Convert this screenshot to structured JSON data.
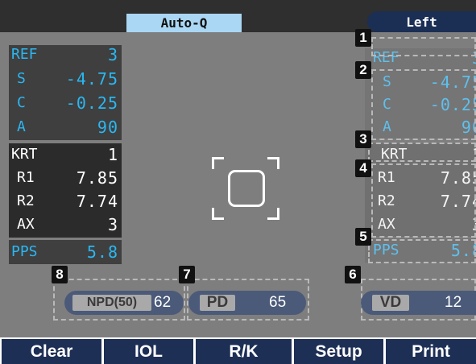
{
  "header": {
    "mode_label": "Auto-Q",
    "eye_label": "Left"
  },
  "left_panel": {
    "ref": {
      "title": "REF",
      "title_value": "3",
      "rows": [
        {
          "label": "S",
          "value": "-4.75"
        },
        {
          "label": "C",
          "value": "-0.25"
        },
        {
          "label": "A",
          "value": "90"
        }
      ]
    },
    "krt": {
      "title": "KRT",
      "title_value": "1",
      "rows": [
        {
          "label": "R1",
          "value": "7.85"
        },
        {
          "label": "R2",
          "value": "7.74"
        },
        {
          "label": "AX",
          "value": "3"
        }
      ]
    },
    "pps": {
      "label": "PPS",
      "value": "5.8"
    }
  },
  "markers": [
    "1",
    "2",
    "3",
    "4",
    "5",
    "6",
    "7",
    "8"
  ],
  "measurements": {
    "npd": {
      "label": "NPD(50)",
      "value": "62"
    },
    "pd": {
      "label": "PD",
      "value": "65"
    },
    "vd": {
      "label": "VD",
      "value": "12"
    }
  },
  "buttons": [
    "Clear",
    "IOL",
    "R/K",
    "Setup",
    "Print"
  ],
  "colors": {
    "screen_bg": "#7e7e7e",
    "cyan_text": "#2ab7f3",
    "button_bg": "#1e2f55",
    "mode_tab_bg": "#aad7f3"
  }
}
